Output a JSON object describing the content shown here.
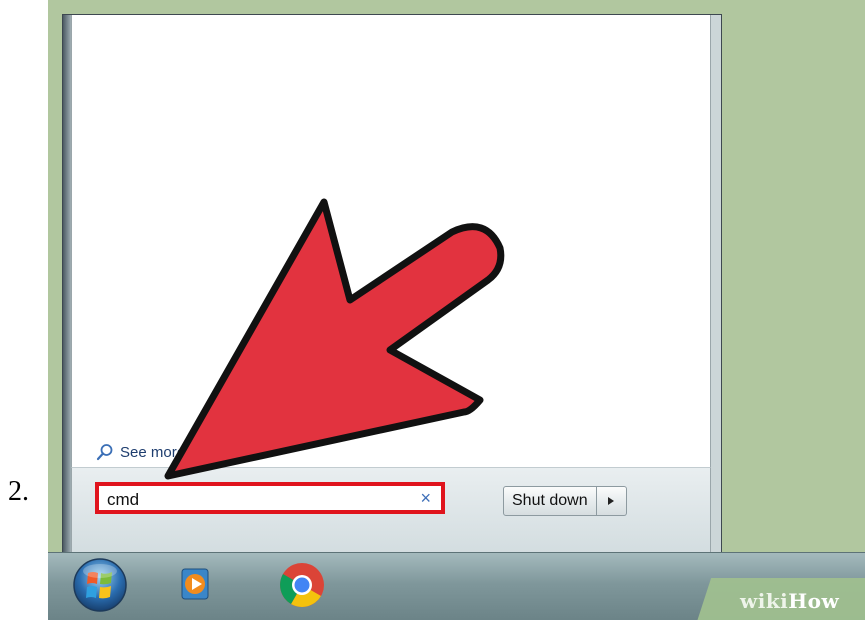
{
  "step": {
    "number": "2."
  },
  "start_menu": {
    "see_more_label": "See more results",
    "search": {
      "value": "cmd",
      "clear_glyph": "×"
    },
    "shutdown_label": "Shut down"
  },
  "taskbar": {
    "icons": [
      "windows-start-orb",
      "windows-media-player",
      "google-chrome"
    ]
  },
  "watermark": {
    "part1": "wiki",
    "part2": "How"
  },
  "colors": {
    "background": "#b1c79f",
    "highlight_box": "#e0141d",
    "arrow": "#e2333f"
  }
}
